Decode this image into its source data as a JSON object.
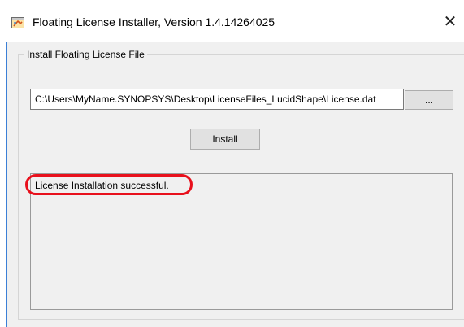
{
  "window": {
    "title": "Floating License Installer, Version 1.4.14264025",
    "close_glyph": "✕",
    "app_icon": "installer-app-icon"
  },
  "group": {
    "label": "Install Floating License File"
  },
  "file_path": {
    "value": "C:\\Users\\MyName.SYNOPSYS\\Desktop\\LicenseFiles_LucidShape\\License.dat"
  },
  "browse_button": {
    "label": "..."
  },
  "install_button": {
    "label": "Install"
  },
  "output": {
    "text": "License Installation successful."
  },
  "colors": {
    "annotation_oval": "#e8101c",
    "window_accent": "#3b7fd6"
  }
}
